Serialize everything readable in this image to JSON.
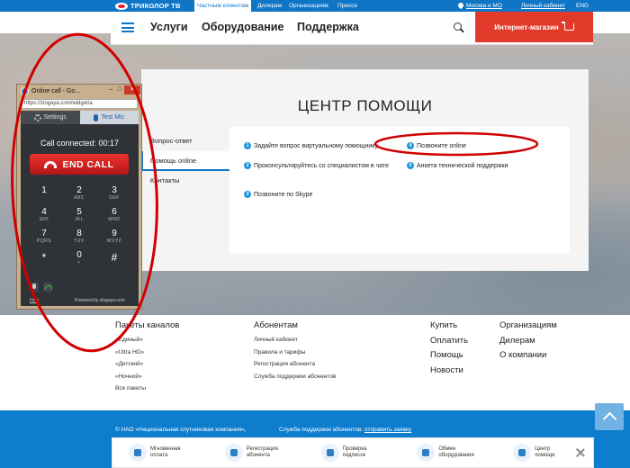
{
  "topbar": {
    "logo_text": "ТРИКОЛОР ТВ",
    "segments": [
      "Частным клиентам",
      "Дилерам",
      "Организациям",
      "Прессе"
    ],
    "region": "Москва и МО",
    "cabinet": "Личный кабинет",
    "lang": "ENG"
  },
  "nav": {
    "items": [
      "Услуги",
      "Оборудование",
      "Поддержка"
    ],
    "shop_label": "Интернет-магазин"
  },
  "help": {
    "title": "ЦЕНТР ПОМОЩИ",
    "menu": [
      "Вопрос-ответ",
      "Помощь online",
      "Контакты"
    ],
    "options": [
      {
        "num": "1",
        "text": "Задайте вопрос виртуальному помощнику"
      },
      {
        "num": "2",
        "text": "Проконсультируйтесь со специалистом в чате"
      },
      {
        "num": "3",
        "text": "Позвоните по Skype"
      },
      {
        "num": "4",
        "text": "Позвоните online"
      },
      {
        "num": "5",
        "text": "Анкета технической поддержки"
      }
    ]
  },
  "footer": {
    "col1": {
      "head": "Пакеты каналов",
      "links": [
        "«Единый»",
        "«Ultra HD»",
        "«Детский»",
        "«Ночной»",
        "Все пакеты"
      ]
    },
    "col2": {
      "head": "Абонентам",
      "links": [
        "Личный кабинет",
        "Правила и тарифы",
        "Регистрация абонента",
        "Служба поддержки абонентов"
      ]
    },
    "col3": [
      "Купить",
      "Оплатить",
      "Помощь",
      "Новости"
    ],
    "col4": [
      "Организациям",
      "Дилерам",
      "О компании"
    ],
    "copyright": "© НАО «Национальная спутниковая компания»,",
    "support_label": "Служба поддержки абонентов:",
    "support_link": "отправить заявку",
    "quick": [
      {
        "l1": "Мгновенная",
        "l2": "оплата"
      },
      {
        "l1": "Регистрация",
        "l2": "абонента"
      },
      {
        "l1": "Проверка",
        "l2": "подписок"
      },
      {
        "l1": "Обмен",
        "l2": "оборудования"
      },
      {
        "l1": "Центр",
        "l2": "помощи"
      }
    ]
  },
  "widget": {
    "title": "Online call - Go...",
    "url": "https://zingaya.com/widget/a",
    "tab_settings": "Settings",
    "tab_mic": "Test Mic",
    "status": "Call connected: 00:17",
    "end_call": "END CALL",
    "keys": [
      {
        "d": "1",
        "l": ""
      },
      {
        "d": "2",
        "l": "ABC"
      },
      {
        "d": "3",
        "l": "DEF"
      },
      {
        "d": "4",
        "l": "GHI"
      },
      {
        "d": "5",
        "l": "JKL"
      },
      {
        "d": "6",
        "l": "MNO"
      },
      {
        "d": "7",
        "l": "PQRS"
      },
      {
        "d": "8",
        "l": "TUV"
      },
      {
        "d": "9",
        "l": "WXYZ"
      },
      {
        "d": "*",
        "l": ""
      },
      {
        "d": "0",
        "l": "+"
      },
      {
        "d": "#",
        "l": ""
      }
    ],
    "help": "Help",
    "powered": "Powered by zingaya.com"
  },
  "colors": {
    "brand_blue": "#0f76c6",
    "shop_red": "#e23a2a",
    "annotation_red": "#d10000"
  }
}
